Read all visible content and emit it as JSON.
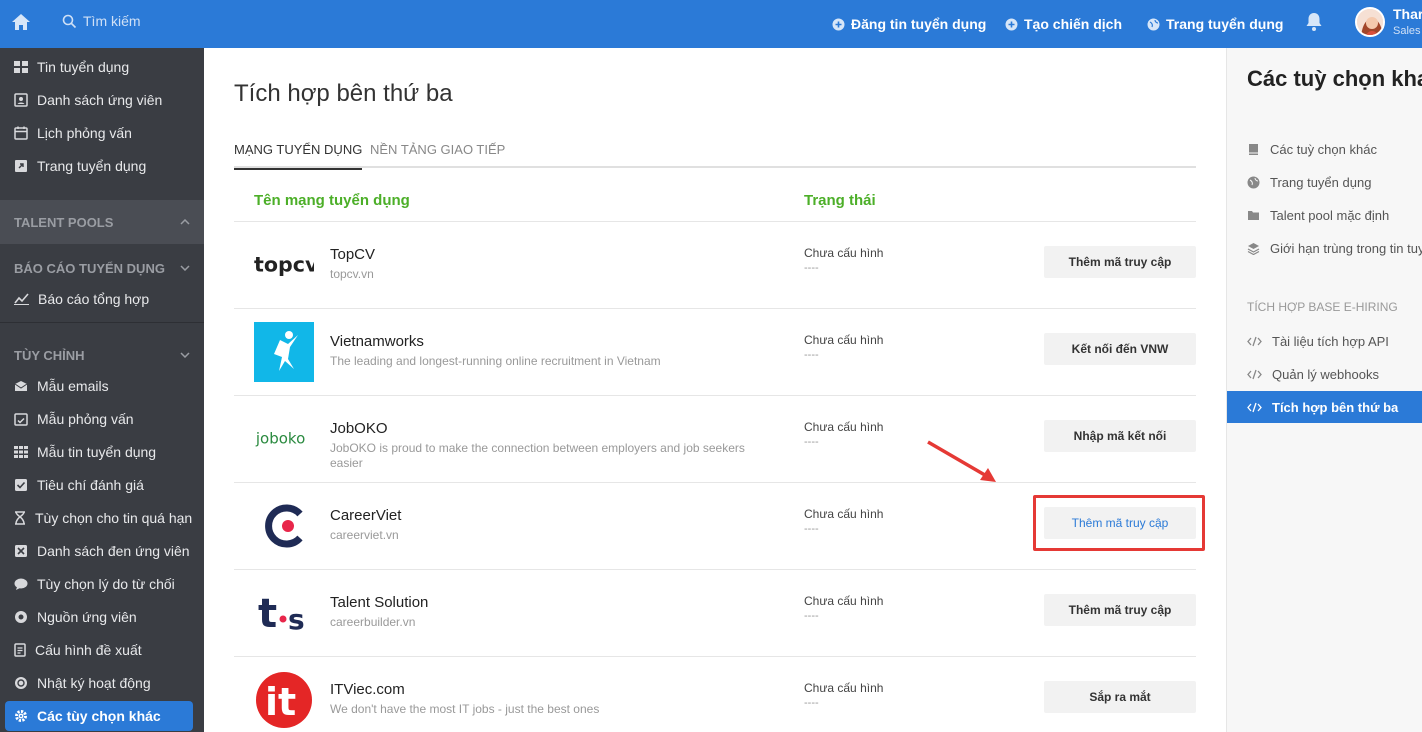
{
  "topbar": {
    "search_placeholder": "Tìm kiếm",
    "post_job": "Đăng tin tuyển dụng",
    "create_campaign": "Tạo chiến dịch",
    "career_page": "Trang tuyển dụng",
    "user_name": "Thar",
    "user_role": "Sales"
  },
  "sidebar": {
    "items_top": [
      {
        "label": "Tin tuyển dụng",
        "icon": "grid-icon"
      },
      {
        "label": "Danh sách ứng viên",
        "icon": "person-card-icon"
      },
      {
        "label": "Lịch phỏng vấn",
        "icon": "calendar-icon"
      },
      {
        "label": "Trang tuyển dụng",
        "icon": "external-link-icon"
      }
    ],
    "talent_pools": "TALENT POOLS",
    "reports_section": "BÁO CÁO TUYỂN DỤNG",
    "report_item": "Báo cáo tổng hợp",
    "custom_section": "TÙY CHỈNH",
    "custom_items": [
      {
        "label": "Mẫu emails",
        "icon": "envelope-icon"
      },
      {
        "label": "Mẫu phỏng vấn",
        "icon": "calendar-check-icon"
      },
      {
        "label": "Mẫu tin tuyển dụng",
        "icon": "list-grid-icon"
      },
      {
        "label": "Tiêu chí đánh giá",
        "icon": "checkbox-icon"
      },
      {
        "label": "Tùy chọn cho tin quá hạn",
        "icon": "hourglass-icon"
      },
      {
        "label": "Danh sách đen ứng viên",
        "icon": "block-icon"
      },
      {
        "label": "Tùy chọn lý do từ chối",
        "icon": "comment-icon"
      },
      {
        "label": "Nguồn ứng viên",
        "icon": "source-icon"
      },
      {
        "label": "Cấu hình đề xuất",
        "icon": "document-icon"
      },
      {
        "label": "Nhật ký hoạt động",
        "icon": "activity-icon"
      },
      {
        "label": "Các tùy chọn khác",
        "icon": "gear-icon"
      }
    ]
  },
  "main": {
    "title": "Tích hợp bên thứ ba",
    "tabs": [
      "MẠNG TUYỂN DỤNG",
      "NỀN TẢNG GIAO TIẾP"
    ],
    "col_name": "Tên mạng tuyển dụng",
    "col_status": "Trạng thái",
    "rows": [
      {
        "name": "TopCV",
        "desc": "topcv.vn",
        "status": "Chưa cấu hình",
        "dash": "----",
        "button": "Thêm mã truy cập"
      },
      {
        "name": "Vietnamworks",
        "desc": "The leading and longest-running online recruitment in Vietnam",
        "status": "Chưa cấu hình",
        "dash": "----",
        "button": "Kết nối đến VNW"
      },
      {
        "name": "JobOKO",
        "desc": "JobOKO is proud to make the connection between employers and job seekers easier",
        "status": "Chưa cấu hình",
        "dash": "----",
        "button": "Nhập mã kết nối"
      },
      {
        "name": "CareerViet",
        "desc": "careerviet.vn",
        "status": "Chưa cấu hình",
        "dash": "----",
        "button": "Thêm mã truy cập"
      },
      {
        "name": "Talent Solution",
        "desc": "careerbuilder.vn",
        "status": "Chưa cấu hình",
        "dash": "----",
        "button": "Thêm mã truy cập"
      },
      {
        "name": "ITViec.com",
        "desc": "We don't have the most IT jobs - just the best ones",
        "status": "Chưa cấu hình",
        "dash": "----",
        "button": "Sắp ra mắt"
      }
    ],
    "logos": {
      "topcv": "topcv",
      "joboko": "joboko",
      "ts_t": "t",
      "ts_s": "s",
      "itviec": "it"
    }
  },
  "rpanel": {
    "title": "Các tuỳ chọn kha",
    "items": [
      {
        "label": "Các tuỳ chọn khác",
        "icon": "book-icon"
      },
      {
        "label": "Trang tuyển dụng",
        "icon": "globe-icon"
      },
      {
        "label": "Talent pool mặc định",
        "icon": "folder-icon"
      },
      {
        "label": "Giới hạn trùng trong tin tuy",
        "icon": "layers-icon"
      }
    ],
    "section": "TÍCH HỢP BASE E-HIRING",
    "api_items": [
      {
        "label": "Tài liệu tích hợp API",
        "icon": "code-icon"
      },
      {
        "label": "Quản lý webhooks",
        "icon": "code-icon"
      },
      {
        "label": "Tích hợp bên thứ ba",
        "icon": "code-icon"
      }
    ]
  },
  "colors": {
    "primary": "#2b7ad7",
    "sidebar": "#3a3d43",
    "green": "#4caf28",
    "highlight": "#e53935"
  }
}
